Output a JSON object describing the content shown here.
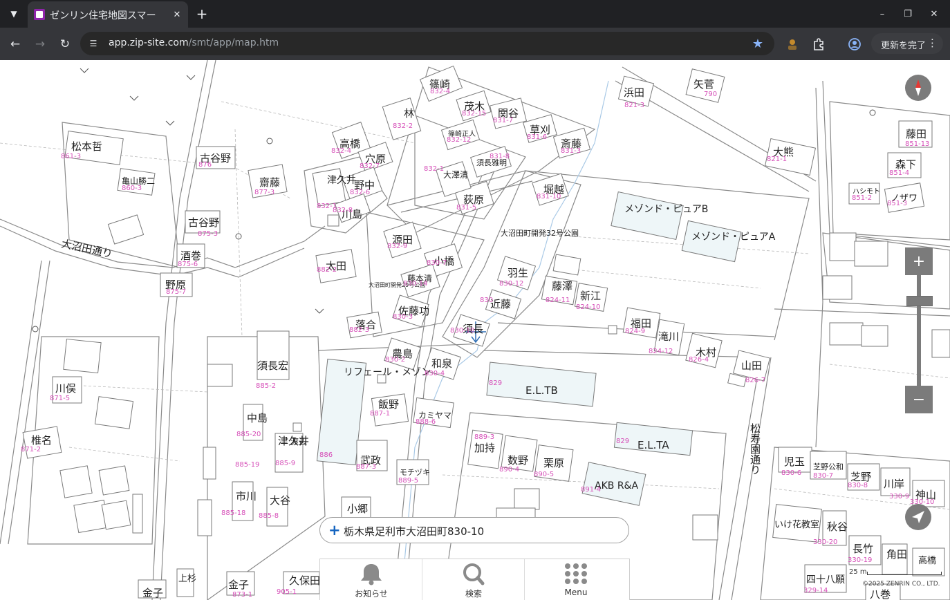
{
  "browser": {
    "tab_title": "ゼンリン住宅地図スマー",
    "url_host": "app.zip-site.com",
    "url_path": "/smt/app/map.htm",
    "update_label": "更新を完了"
  },
  "map": {
    "address": "栃木県足利市大沼田町830-10",
    "scale_label": "25 m",
    "copyright": "©2025 ZENRIN CO., LTD.",
    "menu": [
      {
        "label": "お知らせ"
      },
      {
        "label": "検索"
      },
      {
        "label": "Menu"
      }
    ],
    "zoom_in": "+",
    "zoom_out": "−",
    "road_labels": [
      {
        "text": "大沼田通り"
      },
      {
        "text": "松寿園通り"
      }
    ],
    "buildings": [
      {
        "name": "篠崎",
        "num": "832-4"
      },
      {
        "name": "茂木",
        "num": "832-15"
      },
      {
        "name": "関谷",
        "num": "831-7"
      },
      {
        "name": "草刈",
        "num": "831-6"
      },
      {
        "name": "斎藤",
        "num": "831-3"
      },
      {
        "name": "林",
        "num": "832-2"
      },
      {
        "name": "高橋",
        "num": "832-4"
      },
      {
        "name": "穴原",
        "num": "832-7"
      },
      {
        "name": "古谷野",
        "num": "876"
      },
      {
        "name": "齋藤",
        "num": "877-3"
      },
      {
        "name": "松本哲",
        "num": "861-3"
      },
      {
        "name": "亀山勝二",
        "num": "860-3"
      },
      {
        "name": "野中",
        "num": "832-6"
      },
      {
        "name": "津久井",
        "num": "832-1"
      },
      {
        "name": "川島",
        "num": "832-8"
      },
      {
        "name": "荻原",
        "num": "831-5"
      },
      {
        "name": "大澤清",
        "num": "832-1"
      },
      {
        "name": "須長雅明",
        "num": "831-8"
      },
      {
        "name": "篠崎正人",
        "num": "832-12"
      },
      {
        "name": "堀越",
        "num": "831-10"
      },
      {
        "name": "古谷野",
        "num": "875-3"
      },
      {
        "name": "酒巻",
        "num": "875-6"
      },
      {
        "name": "野原",
        "num": "875-7"
      },
      {
        "name": "源田",
        "num": "832-9"
      },
      {
        "name": "小橋",
        "num": "830-7"
      },
      {
        "name": "太田",
        "num": "882-2"
      },
      {
        "name": "藤本清",
        "num": "830-14"
      },
      {
        "name": "大沼田町開発32号公園",
        "num": ""
      },
      {
        "name": "羽生",
        "num": "830-12"
      },
      {
        "name": "近藤",
        "num": "830"
      },
      {
        "name": "佐藤功",
        "num": "830-3"
      },
      {
        "name": "須長",
        "num": "830-10"
      },
      {
        "name": "落合",
        "num": "882-3"
      },
      {
        "name": "大沼田町開発29号公園",
        "num": ""
      },
      {
        "name": "農島",
        "num": "830-2"
      },
      {
        "name": "和泉",
        "num": "830-4"
      },
      {
        "name": "須長宏",
        "num": "885-2"
      },
      {
        "name": "リフェール・メゾン",
        "num": "886"
      },
      {
        "name": "飯野",
        "num": "887-1"
      },
      {
        "name": "カミヤマ",
        "num": "888-6"
      },
      {
        "name": "E.L.TB",
        "num": "829"
      },
      {
        "name": "E.L.TA",
        "num": "829"
      },
      {
        "name": "藤澤",
        "num": "824-11"
      },
      {
        "name": "新江",
        "num": "824-10"
      },
      {
        "name": "福田",
        "num": "824-9"
      },
      {
        "name": "滝川",
        "num": "824-12"
      },
      {
        "name": "木村",
        "num": "826-4"
      },
      {
        "name": "山田",
        "num": "826-7"
      },
      {
        "name": "メゾンド・ピュアB",
        "num": ""
      },
      {
        "name": "メゾンド・ピュアA",
        "num": ""
      },
      {
        "name": "浜田",
        "num": "821-3"
      },
      {
        "name": "矢菅",
        "num": "790"
      },
      {
        "name": "大熊",
        "num": "821-1"
      },
      {
        "name": "藤田",
        "num": "851-13"
      },
      {
        "name": "森下",
        "num": "851-4"
      },
      {
        "name": "ノザワ",
        "num": "851-3"
      },
      {
        "name": "ハシモト",
        "num": "851-2"
      },
      {
        "name": "川俣",
        "num": "871-5"
      },
      {
        "name": "椎名",
        "num": "871-2"
      },
      {
        "name": "中島",
        "num": "885-20"
      },
      {
        "name": "津久井",
        "num": "885-9"
      },
      {
        "name": "渡辺",
        "num": "885-19"
      },
      {
        "name": "市川",
        "num": "885-18"
      },
      {
        "name": "大谷",
        "num": "885-8"
      },
      {
        "name": "武政",
        "num": "887-3"
      },
      {
        "name": "モチヅキ",
        "num": "889-5"
      },
      {
        "name": "加持",
        "num": "889-3"
      },
      {
        "name": "数野",
        "num": "890-4"
      },
      {
        "name": "栗原",
        "num": "890-5"
      },
      {
        "name": "AKB R&A",
        "num": "891-4"
      },
      {
        "name": "小郷",
        "num": ""
      },
      {
        "name": "児玉",
        "num": "830-6"
      },
      {
        "name": "芝野公和",
        "num": "830-7"
      },
      {
        "name": "芝野",
        "num": "830-8"
      },
      {
        "name": "川岸",
        "num": "330-9"
      },
      {
        "name": "神山",
        "num": "330-10"
      },
      {
        "name": "いけ花教室",
        "num": ""
      },
      {
        "name": "秋谷",
        "num": "330-20"
      },
      {
        "name": "長竹",
        "num": "330-19"
      },
      {
        "name": "角田",
        "num": ""
      },
      {
        "name": "四十八願",
        "num": "329-14"
      },
      {
        "name": "高橋",
        "num": ""
      },
      {
        "name": "金子",
        "num": "873-1"
      },
      {
        "name": "久保田",
        "num": "905-1"
      },
      {
        "name": "上杉",
        "num": ""
      },
      {
        "name": "金子",
        "num": ""
      },
      {
        "name": "八巻",
        "num": ""
      }
    ]
  },
  "icons": {
    "compass": "compass-icon",
    "locate": "navigation-arrow-icon",
    "bell": "bell-icon",
    "search": "search-icon",
    "menu": "grid-menu-icon"
  }
}
